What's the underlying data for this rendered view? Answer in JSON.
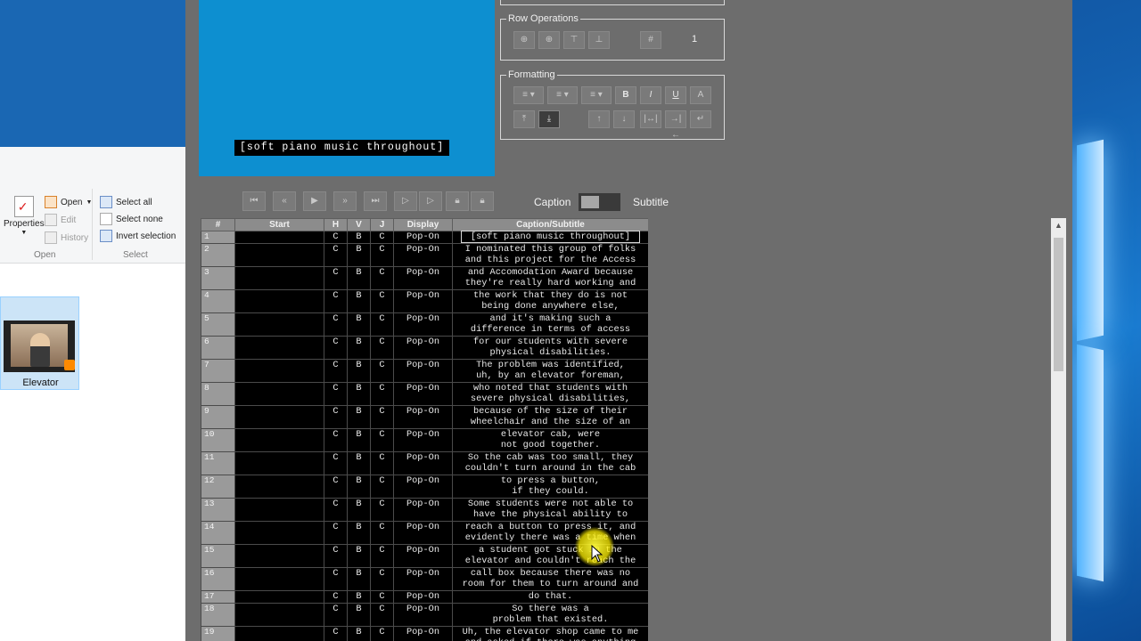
{
  "explorer": {
    "ribbon": {
      "properties": "Properties",
      "open": "Open",
      "edit": "Edit",
      "history": "History",
      "select_all": "Select all",
      "select_none": "Select none",
      "invert_selection": "Invert selection",
      "group_open": "Open",
      "group_select": "Select"
    },
    "file": {
      "name": "Elevator"
    }
  },
  "app": {
    "video_caption": "[soft piano music throughout]",
    "row_operations": {
      "legend": "Row Operations",
      "row_number": "1"
    },
    "formatting": {
      "legend": "Formatting"
    },
    "toggle": {
      "left_label": "Caption",
      "right_label": "Subtitle"
    },
    "grid": {
      "headers": [
        "#",
        "Start",
        "H",
        "V",
        "J",
        "Display",
        "Caption/Subtitle"
      ],
      "rows": [
        {
          "n": "1",
          "h": "C",
          "v": "B",
          "j": "C",
          "display": "Pop-On",
          "caption": "[soft piano music throughout]",
          "selected": true
        },
        {
          "n": "2",
          "h": "C",
          "v": "B",
          "j": "C",
          "display": "Pop-On",
          "caption": "I nominated this group of folks\nand this project for the Access"
        },
        {
          "n": "3",
          "h": "C",
          "v": "B",
          "j": "C",
          "display": "Pop-On",
          "caption": "and Accomodation Award because\nthey're really hard working and"
        },
        {
          "n": "4",
          "h": "C",
          "v": "B",
          "j": "C",
          "display": "Pop-On",
          "caption": "the work that they do is not\nbeing done anywhere else,"
        },
        {
          "n": "5",
          "h": "C",
          "v": "B",
          "j": "C",
          "display": "Pop-On",
          "caption": "and it's making such a\ndifference in terms of access"
        },
        {
          "n": "6",
          "h": "C",
          "v": "B",
          "j": "C",
          "display": "Pop-On",
          "caption": "for our students with severe\nphysical disabilities."
        },
        {
          "n": "7",
          "h": "C",
          "v": "B",
          "j": "C",
          "display": "Pop-On",
          "caption": "The problem was identified,\nuh, by an elevator foreman,"
        },
        {
          "n": "8",
          "h": "C",
          "v": "B",
          "j": "C",
          "display": "Pop-On",
          "caption": "who noted that students with\nsevere physical disabilities,"
        },
        {
          "n": "9",
          "h": "C",
          "v": "B",
          "j": "C",
          "display": "Pop-On",
          "caption": "because of the size of their\nwheelchair and the size of an"
        },
        {
          "n": "10",
          "h": "C",
          "v": "B",
          "j": "C",
          "display": "Pop-On",
          "caption": "elevator cab, were\nnot good together."
        },
        {
          "n": "11",
          "h": "C",
          "v": "B",
          "j": "C",
          "display": "Pop-On",
          "caption": "So the cab was too small, they\ncouldn't turn around in the cab"
        },
        {
          "n": "12",
          "h": "C",
          "v": "B",
          "j": "C",
          "display": "Pop-On",
          "caption": "to press a button,\nif they could."
        },
        {
          "n": "13",
          "h": "C",
          "v": "B",
          "j": "C",
          "display": "Pop-On",
          "caption": "Some students were not able to\nhave the physical ability to"
        },
        {
          "n": "14",
          "h": "C",
          "v": "B",
          "j": "C",
          "display": "Pop-On",
          "caption": "reach a button to press it, and\nevidently there was a time when"
        },
        {
          "n": "15",
          "h": "C",
          "v": "B",
          "j": "C",
          "display": "Pop-On",
          "caption": "a student got stuck in the\nelevator and couldn't reach the"
        },
        {
          "n": "16",
          "h": "C",
          "v": "B",
          "j": "C",
          "display": "Pop-On",
          "caption": "call box because there was no\nroom for them to turn around and"
        },
        {
          "n": "17",
          "h": "C",
          "v": "B",
          "j": "C",
          "display": "Pop-On",
          "caption": "do that."
        },
        {
          "n": "18",
          "h": "C",
          "v": "B",
          "j": "C",
          "display": "Pop-On",
          "caption": "So there was a\nproblem that existed."
        },
        {
          "n": "19",
          "h": "C",
          "v": "B",
          "j": "C",
          "display": "Pop-On",
          "caption": "Uh, the elevator shop came to me\nand asked if there was anything"
        }
      ]
    }
  },
  "colors": {
    "app_bg": "#6d6d6d",
    "video_bg": "#0d8fd0",
    "grid_bg": "#000000",
    "cursor_highlight": "#fff23c"
  }
}
